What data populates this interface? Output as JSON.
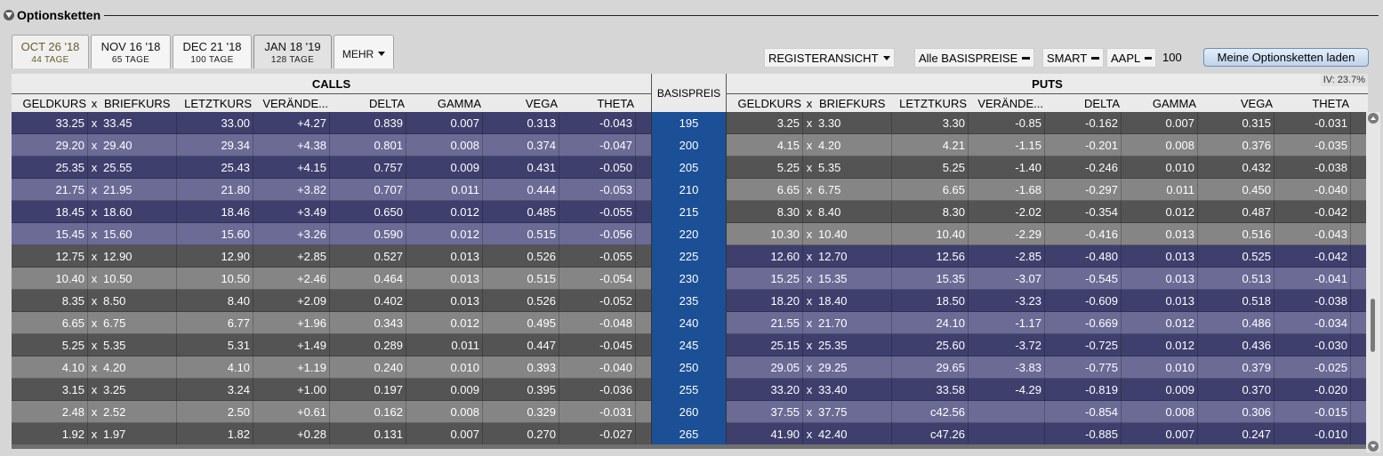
{
  "section": {
    "title": "Optionsketten"
  },
  "tabs": [
    {
      "date": "OCT 26 '18",
      "days": "44 TAGE"
    },
    {
      "date": "NOV 16 '18",
      "days": "65 TAGE"
    },
    {
      "date": "DEC 21 '18",
      "days": "100 TAGE"
    },
    {
      "date": "JAN 18 '19",
      "days": "128 TAGE"
    }
  ],
  "more_tab": "MEHR",
  "toolbar": {
    "view": "REGISTERANSICHT",
    "strikes": "Alle BASISPREISE",
    "exchange": "SMART",
    "symbol": "AAPL",
    "quantity": "100",
    "load_button": "Meine Optionsketten laden"
  },
  "header": {
    "calls": "CALLS",
    "puts": "PUTS",
    "strike": "BASISPREIS",
    "iv": "IV: 23.7%",
    "columns": {
      "bid": "GELDKURS",
      "x": "x",
      "ask": "BRIEFKURS",
      "last": "LETZTKURS",
      "change": "VERÄNDE...",
      "delta": "DELTA",
      "gamma": "GAMMA",
      "vega": "VEGA",
      "theta": "THETA"
    }
  },
  "colors": {
    "calls_itm_a": "#3f3f6e",
    "calls_itm_b": "#6b6b96",
    "calls_otm_a": "#545454",
    "calls_otm_b": "#858585",
    "strike": "#1b4f96"
  },
  "rows": [
    {
      "strike": "195",
      "call": [
        "33.25",
        "33.45",
        "33.00",
        "+4.27",
        "0.839",
        "0.007",
        "0.313",
        "-0.043"
      ],
      "put": [
        "3.25",
        "3.30",
        "3.30",
        "-0.85",
        "-0.162",
        "0.007",
        "0.315",
        "-0.031"
      ],
      "call_itm": true
    },
    {
      "strike": "200",
      "call": [
        "29.20",
        "29.40",
        "29.34",
        "+4.38",
        "0.801",
        "0.008",
        "0.374",
        "-0.047"
      ],
      "put": [
        "4.15",
        "4.20",
        "4.21",
        "-1.15",
        "-0.201",
        "0.008",
        "0.376",
        "-0.035"
      ],
      "call_itm": true
    },
    {
      "strike": "205",
      "call": [
        "25.35",
        "25.55",
        "25.43",
        "+4.15",
        "0.757",
        "0.009",
        "0.431",
        "-0.050"
      ],
      "put": [
        "5.25",
        "5.35",
        "5.25",
        "-1.40",
        "-0.246",
        "0.010",
        "0.432",
        "-0.038"
      ],
      "call_itm": true
    },
    {
      "strike": "210",
      "call": [
        "21.75",
        "21.95",
        "21.80",
        "+3.82",
        "0.707",
        "0.011",
        "0.444",
        "-0.053"
      ],
      "put": [
        "6.65",
        "6.75",
        "6.65",
        "-1.68",
        "-0.297",
        "0.011",
        "0.450",
        "-0.040"
      ],
      "call_itm": true
    },
    {
      "strike": "215",
      "call": [
        "18.45",
        "18.60",
        "18.46",
        "+3.49",
        "0.650",
        "0.012",
        "0.485",
        "-0.055"
      ],
      "put": [
        "8.30",
        "8.40",
        "8.30",
        "-2.02",
        "-0.354",
        "0.012",
        "0.487",
        "-0.042"
      ],
      "call_itm": true
    },
    {
      "strike": "220",
      "call": [
        "15.45",
        "15.60",
        "15.60",
        "+3.26",
        "0.590",
        "0.012",
        "0.515",
        "-0.056"
      ],
      "put": [
        "10.30",
        "10.40",
        "10.40",
        "-2.29",
        "-0.416",
        "0.013",
        "0.516",
        "-0.043"
      ],
      "call_itm": true
    },
    {
      "strike": "225",
      "call": [
        "12.75",
        "12.90",
        "12.90",
        "+2.85",
        "0.527",
        "0.013",
        "0.526",
        "-0.055"
      ],
      "put": [
        "12.60",
        "12.70",
        "12.56",
        "-2.85",
        "-0.480",
        "0.013",
        "0.525",
        "-0.042"
      ],
      "call_itm": false
    },
    {
      "strike": "230",
      "call": [
        "10.40",
        "10.50",
        "10.50",
        "+2.46",
        "0.464",
        "0.013",
        "0.515",
        "-0.054"
      ],
      "put": [
        "15.25",
        "15.35",
        "15.35",
        "-3.07",
        "-0.545",
        "0.013",
        "0.513",
        "-0.041"
      ],
      "call_itm": false
    },
    {
      "strike": "235",
      "call": [
        "8.35",
        "8.50",
        "8.40",
        "+2.09",
        "0.402",
        "0.013",
        "0.526",
        "-0.052"
      ],
      "put": [
        "18.20",
        "18.40",
        "18.50",
        "-3.23",
        "-0.609",
        "0.013",
        "0.518",
        "-0.038"
      ],
      "call_itm": false
    },
    {
      "strike": "240",
      "call": [
        "6.65",
        "6.75",
        "6.77",
        "+1.96",
        "0.343",
        "0.012",
        "0.495",
        "-0.048"
      ],
      "put": [
        "21.55",
        "21.70",
        "24.10",
        "-1.17",
        "-0.669",
        "0.012",
        "0.486",
        "-0.034"
      ],
      "call_itm": false
    },
    {
      "strike": "245",
      "call": [
        "5.25",
        "5.35",
        "5.31",
        "+1.49",
        "0.289",
        "0.011",
        "0.447",
        "-0.045"
      ],
      "put": [
        "25.15",
        "25.35",
        "25.60",
        "-3.72",
        "-0.725",
        "0.012",
        "0.436",
        "-0.030"
      ],
      "call_itm": false
    },
    {
      "strike": "250",
      "call": [
        "4.10",
        "4.20",
        "4.10",
        "+1.19",
        "0.240",
        "0.010",
        "0.393",
        "-0.040"
      ],
      "put": [
        "29.05",
        "29.25",
        "29.65",
        "-3.83",
        "-0.775",
        "0.010",
        "0.379",
        "-0.025"
      ],
      "call_itm": false
    },
    {
      "strike": "255",
      "call": [
        "3.15",
        "3.25",
        "3.24",
        "+1.00",
        "0.197",
        "0.009",
        "0.395",
        "-0.036"
      ],
      "put": [
        "33.20",
        "33.40",
        "33.58",
        "-4.29",
        "-0.819",
        "0.009",
        "0.370",
        "-0.020"
      ],
      "call_itm": false
    },
    {
      "strike": "260",
      "call": [
        "2.48",
        "2.52",
        "2.50",
        "+0.61",
        "0.162",
        "0.008",
        "0.329",
        "-0.031"
      ],
      "put": [
        "37.55",
        "37.75",
        "c42.56",
        "",
        "-0.854",
        "0.008",
        "0.306",
        "-0.015"
      ],
      "call_itm": false
    },
    {
      "strike": "265",
      "call": [
        "1.92",
        "1.97",
        "1.82",
        "+0.28",
        "0.131",
        "0.007",
        "0.270",
        "-0.027"
      ],
      "put": [
        "41.90",
        "42.40",
        "c47.26",
        "",
        "-0.885",
        "0.007",
        "0.247",
        "-0.010"
      ],
      "call_itm": false
    }
  ]
}
